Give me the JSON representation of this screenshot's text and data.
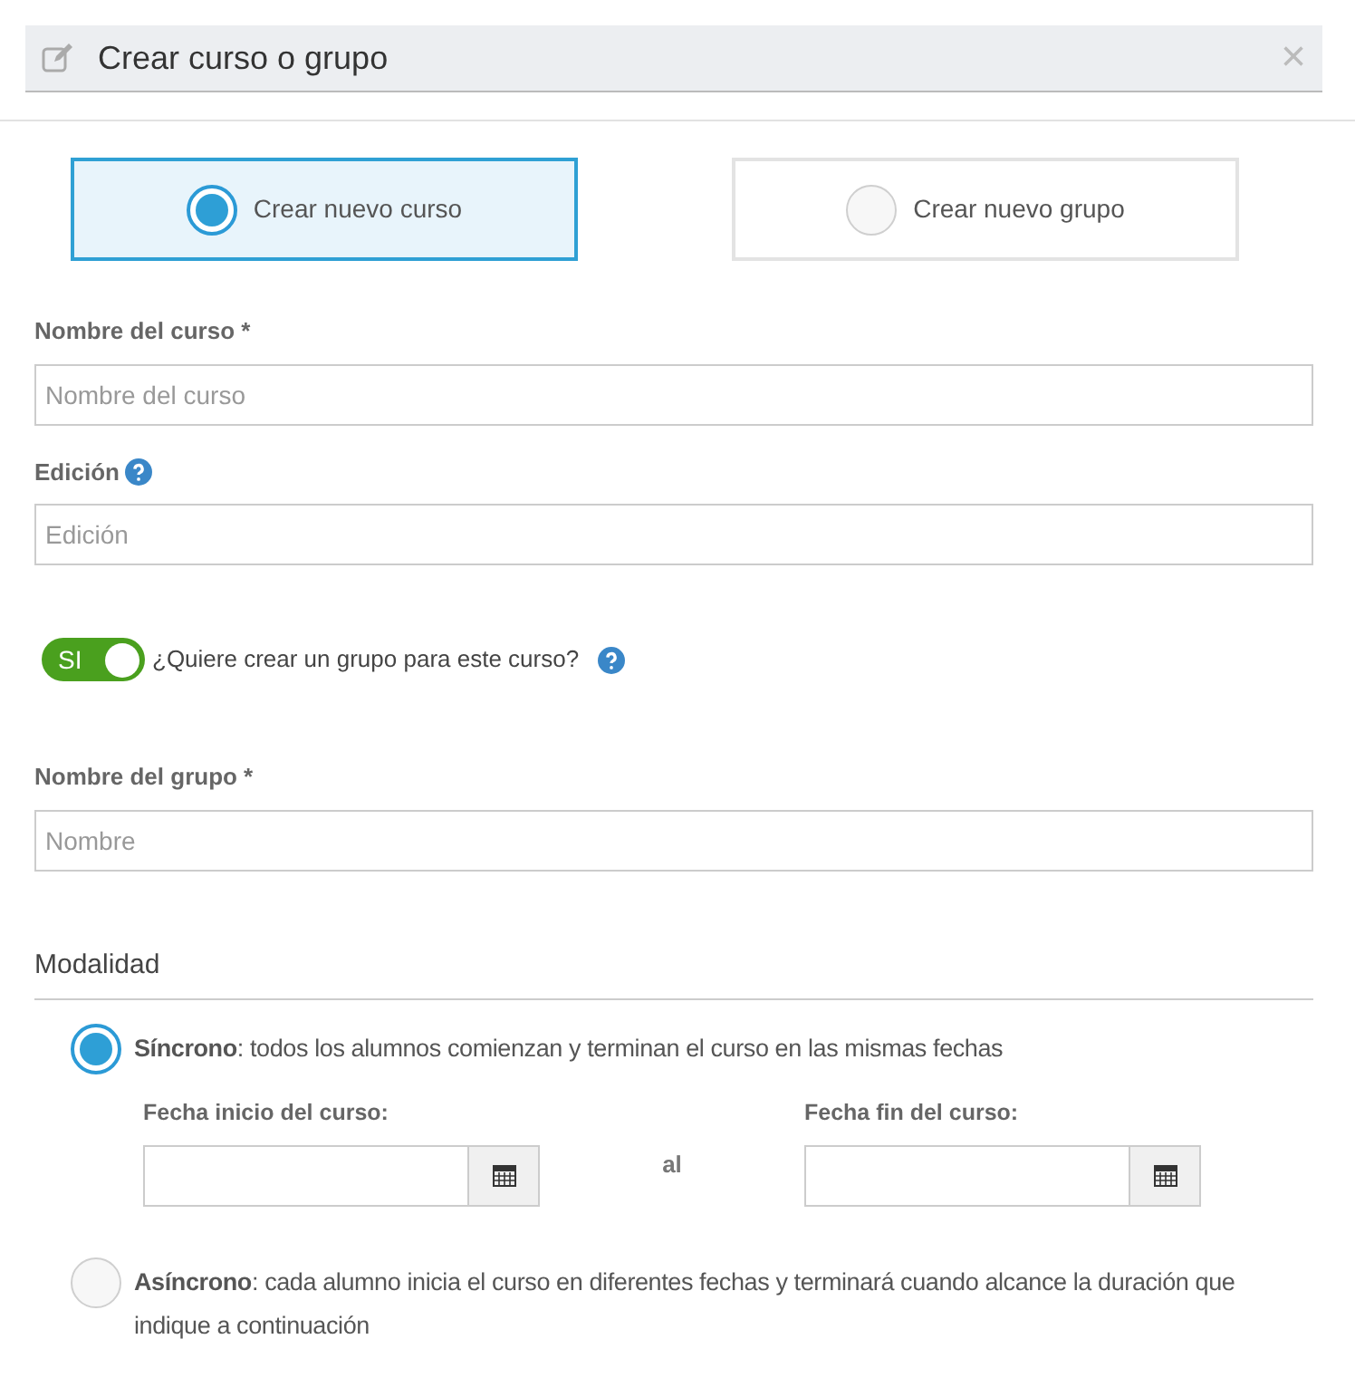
{
  "dialog": {
    "title": "Crear curso o grupo",
    "close": "×"
  },
  "choices": [
    {
      "label": "Crear nuevo curso",
      "selected": true
    },
    {
      "label": "Crear nuevo grupo",
      "selected": false
    }
  ],
  "fields": [
    {
      "label": "Nombre del curso *",
      "help": false,
      "placeholder": "Nombre del curso"
    },
    {
      "label": "Edición",
      "help": true,
      "placeholder": "Edición"
    }
  ],
  "group_toggle": {
    "on": true,
    "on_text": "SI",
    "label": "¿Quiere crear un grupo para este curso?"
  },
  "group_field": {
    "label": "Nombre del grupo *",
    "placeholder": "Nombre"
  },
  "modalidad": {
    "heading": "Modalidad",
    "options": [
      {
        "text": "**Síncrono**: todos los alumnos comienzan y terminan el curso en las mismas fechas",
        "selected": true,
        "dates": {
          "start_label": "Fecha inicio del curso:",
          "separator": "al",
          "end_label": "Fecha fin del curso:"
        }
      },
      {
        "text": "**Asíncrono**: cada alumno inicia el curso en diferentes fechas y terminará cuando alcance la duración que indique a continuación",
        "selected": false
      }
    ]
  }
}
